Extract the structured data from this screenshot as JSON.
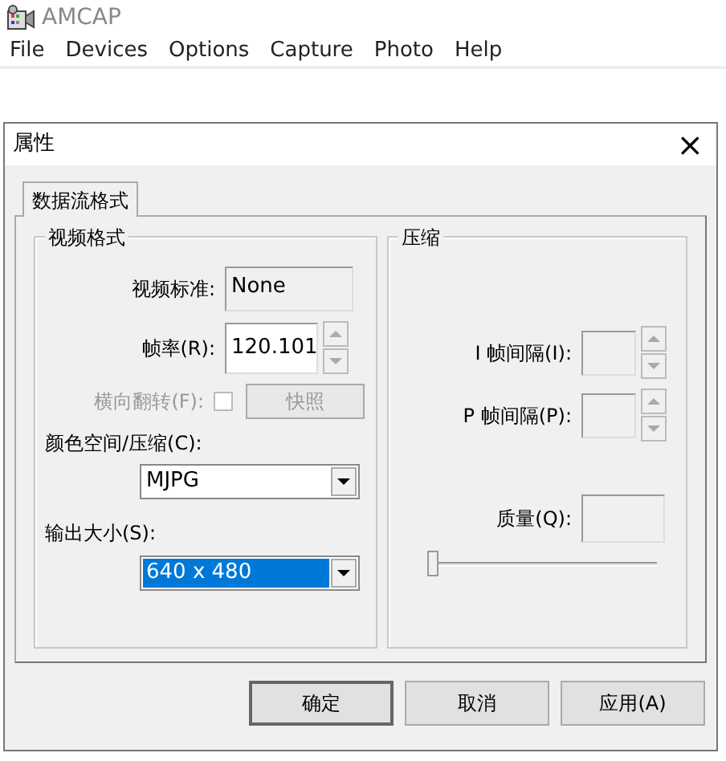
{
  "app": {
    "title": "AMCAP",
    "menu": [
      "File",
      "Devices",
      "Options",
      "Capture",
      "Photo",
      "Help"
    ]
  },
  "dialog": {
    "title": "属性",
    "close": "×",
    "tabs": [
      {
        "label": "数据流格式",
        "selected": true
      }
    ],
    "video_format": {
      "title": "视频格式",
      "video_standard": {
        "label": "视频标准:",
        "value": "None"
      },
      "frame_rate": {
        "label": "帧率(R):",
        "value": "120.101"
      },
      "flip": {
        "label": "横向翻转(F):",
        "checked": false,
        "disabled": true
      },
      "snapshot_button": {
        "label": "快照",
        "disabled": true
      },
      "color_space": {
        "label": "颜色空间/压缩(C):",
        "value": "MJPG"
      },
      "output_size": {
        "label": "输出大小(S):",
        "value": "640 x 480",
        "selected": true
      }
    },
    "compression": {
      "title": "压缩",
      "i_frame": {
        "label": "I 帧间隔(I):"
      },
      "p_frame": {
        "label": "P 帧间隔(P):"
      },
      "quality": {
        "label": "质量(Q):",
        "level": 0
      }
    },
    "buttons": [
      "确定",
      "取消",
      "应用(A)"
    ]
  }
}
